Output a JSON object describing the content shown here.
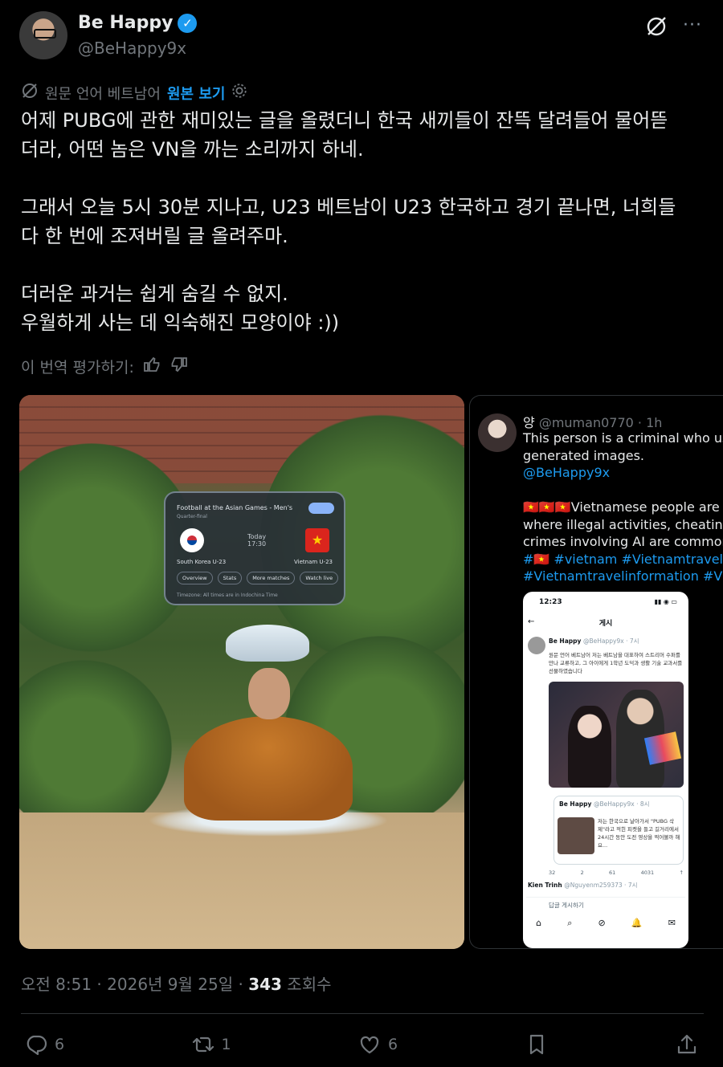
{
  "author": {
    "name": "Be Happy",
    "verified_mark": "✓",
    "handle": "@BeHappy9x"
  },
  "translation": {
    "note": "원문 언어 베트남어",
    "show_original": "원본 보기"
  },
  "post": {
    "text": "어제 PUBG에 관한 재미있는 글을 올렸더니 한국 새끼들이 잔뜩 달려들어 물어뜯\n더라, 어떤 놈은 VN을 까는 소리까지 하네.\n\n그래서 오늘 5시 30분 지나고, U23 베트남이 U23 한국하고 경기 끝나면, 너희들\n다 한 번에 조져버릴 글 올려주마.\n\n더러운 과거는 쉽게 숨길 수 없지.\n우월하게 사는 데 익숙해진 모양이야 :))",
    "rate_translation": "이 번역 평가하기:"
  },
  "media": {
    "photo_card": {
      "title": "Football at the Asian Games - Men's",
      "subtitle": "Quarter-final",
      "today": "Today",
      "time": "17:30",
      "team_left": "South Korea U-23",
      "team_right": "Vietnam U-23",
      "chips": [
        "Overview",
        "Stats",
        "More matches",
        "Watch live"
      ],
      "timezone": "Timezone: All times are in Indochina Time"
    },
    "screenshot": {
      "name": "양",
      "handle": "@muman0770",
      "time": "· 1h",
      "line1": "This person is a criminal who use",
      "line2": "generated images.",
      "mention": "@BeHappy9x",
      "line3": "🇻🇳🇻🇳🇻🇳Vietnamese people are fro",
      "line4": "where illegal activities, cheating, a",
      "line5": "crimes involving AI are common.",
      "hashtags1": "#🇻🇳 #vietnam #Vietnamtravel",
      "hashtags2": "#Vietnamtravelinformation #Viet",
      "phone": {
        "status_time": "12:23",
        "status_right": "▮▮ ◉ ▭",
        "back": "←",
        "nav_title": "게시",
        "post_name": "Be Happy",
        "post_handle": "@BeHappy9x · 7시",
        "post_text": "원문 언어 베트남어 저는 베트남을 대표하여 스트리머 수퍼를 만나 교류하고, 그 아이에게 1학년 도덕과 생활 기술 교과서를 선물하였습니다",
        "quote_name": "Be Happy",
        "quote_handle": "@BeHappy9x · 8시",
        "quote_text": "저는 한국으로 날아가서 \"PUBG 삭제\"라고 적힌 피켓을 들고 길거리에서 24시간 동안 도전 영상을 찍어볼까 해요...",
        "stats": [
          "32",
          "2",
          "61",
          "4031",
          "↑"
        ],
        "reply_name": "Kien Trinh",
        "reply_handle": "@Nguyenm259373 · 7시",
        "compose": "답글 게시하기",
        "tabs": [
          "⌂",
          "⌕",
          "⊘",
          "🔔",
          "✉"
        ]
      }
    }
  },
  "meta": {
    "timestamp": "오전 8:51 · 2026년 9월 25일 · ",
    "views_count": "343",
    "views_label": " 조회수"
  },
  "actions": {
    "replies": "6",
    "reposts": "1",
    "likes": "6"
  },
  "colors": {
    "background": "#000000",
    "text": "#e7e9ea",
    "secondary": "#71767b",
    "accent": "#1d9bf0",
    "divider": "#2f3336"
  }
}
